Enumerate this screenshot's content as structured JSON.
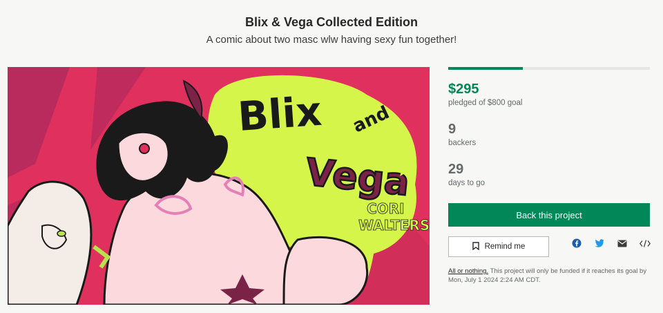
{
  "project": {
    "title": "Blix & Vega Collected Edition",
    "subtitle": "A comic about two masc wlw having sexy fun together!"
  },
  "hero": {
    "logo_line1": "Blix",
    "logo_and": "and",
    "logo_line2": "Vega",
    "author_line1": "CORI",
    "author_line2": "WALTERS",
    "colors": {
      "bg": "#e0305e",
      "accent": "#d6f54a",
      "logo_fill": "#7a2347"
    }
  },
  "stats": {
    "progress_fraction": 0.37,
    "pledged_value": "$295",
    "pledged_label": "pledged of $800 goal",
    "backers_value": "9",
    "backers_label": "backers",
    "days_value": "29",
    "days_label": "days to go"
  },
  "actions": {
    "back_label": "Back this project",
    "remind_label": "Remind me",
    "share_icons": [
      "facebook-icon",
      "twitter-icon",
      "email-icon",
      "embed-icon"
    ]
  },
  "funding": {
    "link_text": "All or nothing.",
    "text": "This project will only be funded if it reaches its goal by",
    "deadline": "Mon, July 1 2024 2:24 AM CDT."
  },
  "colors": {
    "primary": "#028858",
    "text": "#282828",
    "muted": "#656969"
  }
}
